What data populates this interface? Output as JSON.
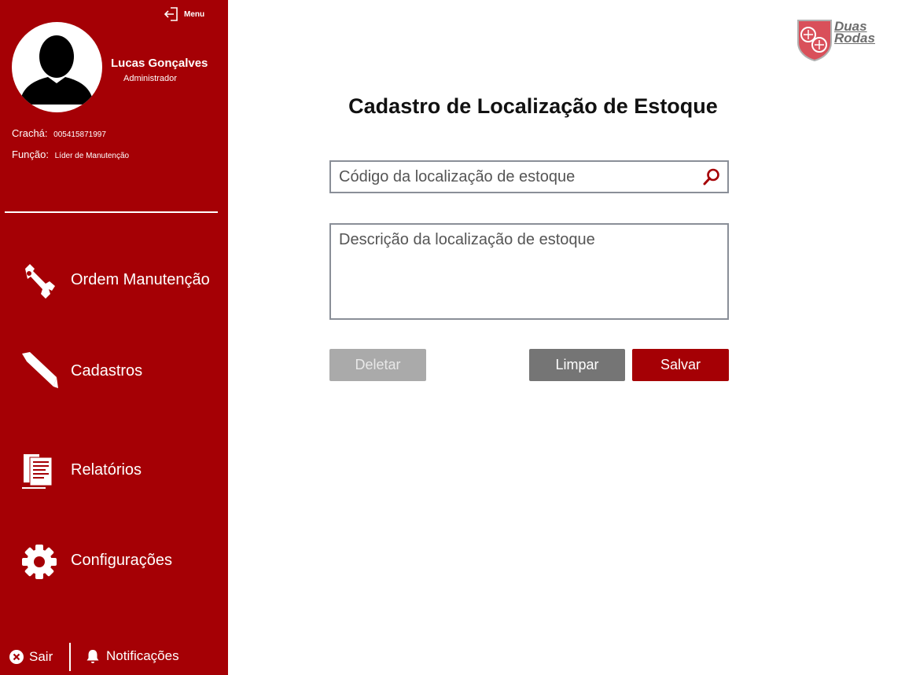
{
  "sidebar": {
    "menu_label": "Menu",
    "user": {
      "name": "Lucas Gonçalves",
      "role": "Administrador",
      "badge_label": "Crachá:",
      "badge_value": "005415871997",
      "function_label": "Função:",
      "function_value": "Líder de Manutenção"
    },
    "nav": [
      {
        "label": "Ordem Manutenção",
        "icon": "wrench-icon"
      },
      {
        "label": "Cadastros",
        "icon": "pencil-icon"
      },
      {
        "label": "Relatórios",
        "icon": "report-icon"
      },
      {
        "label": "Configurações",
        "icon": "gear-icon"
      }
    ],
    "logout_label": "Sair",
    "notifications_label": "Notificações"
  },
  "brand": {
    "line1": "Duas",
    "line2": "Rodas",
    "primary_color": "#a50005"
  },
  "form": {
    "title": "Cadastro de Localização de Estoque",
    "code_placeholder": "Código da localização de estoque",
    "description_placeholder": "Descrição da localização de estoque",
    "delete_label": "Deletar",
    "clear_label": "Limpar",
    "save_label": "Salvar"
  }
}
